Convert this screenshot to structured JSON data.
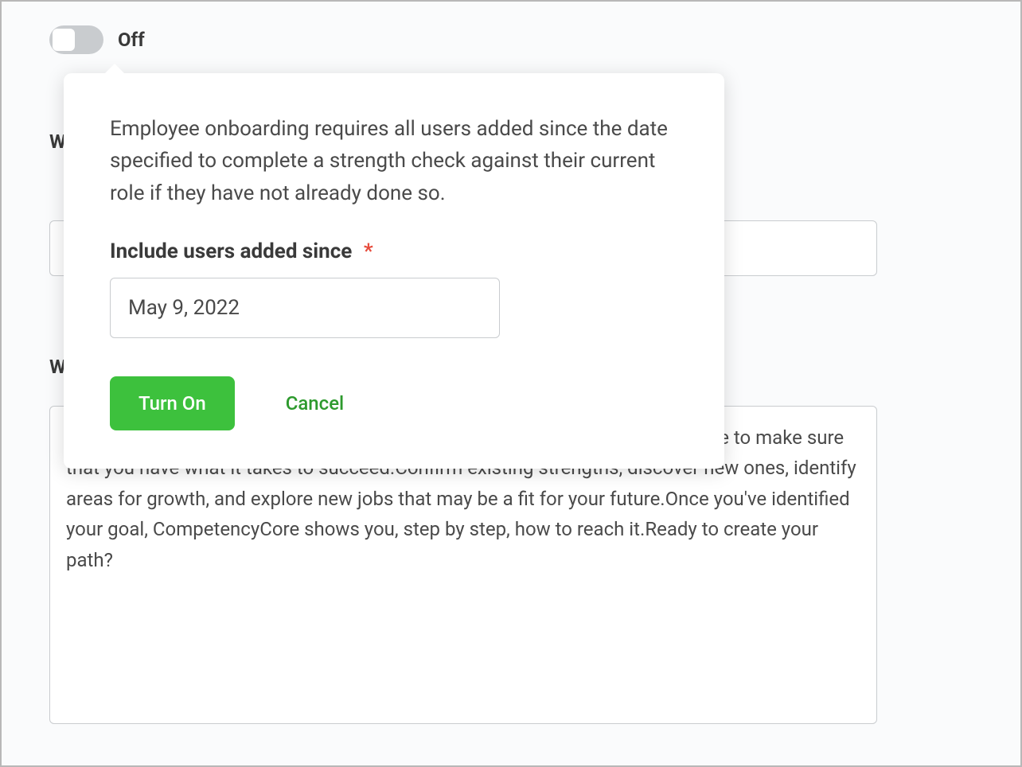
{
  "toggle": {
    "label": "Off",
    "state": false
  },
  "background": {
    "label1_partial": "W",
    "label2_partial": "W",
    "textarea_content": "Welcome to CompetencyCore!It's time to compare yourself to your current role to make sure that you have what it takes to succeed.Confirm existing strengths, discover new ones, identify areas for growth, and explore new jobs that may be a fit for your future.Once you've identified your goal, CompetencyCore shows you, step by step, how to reach it.Ready to create your path?"
  },
  "popover": {
    "description": "Employee onboarding requires all users added since the date specified to complete a strength check against their current role if they have not already done so.",
    "field_label": "Include users added since",
    "required_marker": "*",
    "date_value": "May 9, 2022",
    "turn_on_label": "Turn On",
    "cancel_label": "Cancel"
  }
}
